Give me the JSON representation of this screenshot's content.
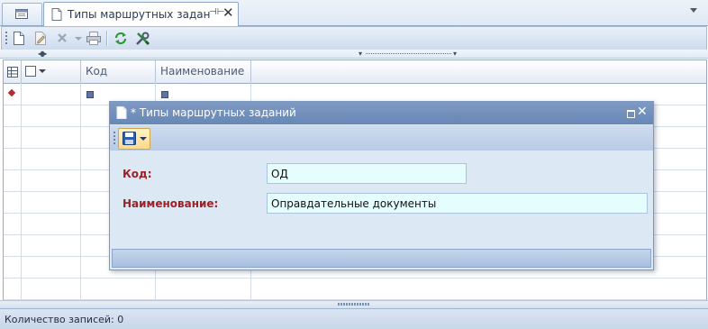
{
  "tab": {
    "title": "Типы маршрутных задан",
    "pin_icon": "pin-icon",
    "close_icon": "close-icon"
  },
  "toolbar": {
    "buttons": [
      "new-icon",
      "edit-icon",
      "delete-icon",
      "print-icon",
      "refresh-icon",
      "settings-icon"
    ]
  },
  "grid": {
    "columns": [
      {
        "label": "Код"
      },
      {
        "label": "Наименование"
      }
    ],
    "empty_rows": 9
  },
  "status": {
    "record_count": "Количество записей: 0"
  },
  "dialog": {
    "title": "* Типы маршрутных заданий",
    "fields": [
      {
        "label": "Код:",
        "value": "ОД"
      },
      {
        "label": "Наименование:",
        "value": "Оправдательные документы"
      }
    ]
  },
  "colors": {
    "accent": "#6787b5",
    "label_red": "#9a2226",
    "input_bg": "#e6fdfd"
  }
}
